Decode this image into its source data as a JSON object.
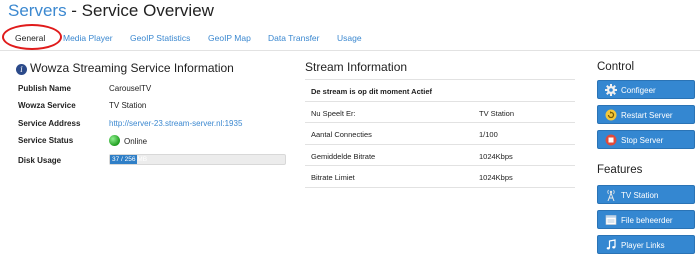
{
  "header": {
    "crumb": "Servers",
    "rest": " - Service Overview"
  },
  "tabs": [
    "General",
    "Media Player",
    "GeoIP Statistics",
    "GeoIP Map",
    "Data Transfer",
    "Usage"
  ],
  "info": {
    "title": "Wowza Streaming Service Information",
    "rows": [
      {
        "label": "Publish Name",
        "value": "CarouselTV"
      },
      {
        "label": "Wowza Service",
        "value": "TV Station"
      },
      {
        "label": "Service Address",
        "value": "http://server-23.stream-server.nl:1935"
      },
      {
        "label": "Service Status",
        "value": "Online"
      },
      {
        "label": "Disk Usage",
        "value": "37 / 256 MB"
      }
    ],
    "disk_usage_fraction": 0.156,
    "status_color": "#1f9d1f"
  },
  "stream": {
    "title": "Stream Information",
    "status_line": "De stream is op dit moment Actief",
    "rows": [
      {
        "label": "Nu Speelt Er:",
        "value": "TV Station"
      },
      {
        "label": "Aantal Connecties",
        "value": "1/100"
      },
      {
        "label": "Gemiddelde Bitrate",
        "value": "1024Kbps"
      },
      {
        "label": "Bitrate Limiet",
        "value": "1024Kbps"
      }
    ]
  },
  "control": {
    "heading": "Control",
    "buttons": [
      {
        "label": "Configeer",
        "icon": "gear-icon"
      },
      {
        "label": "Restart Server",
        "icon": "restart-icon"
      },
      {
        "label": "Stop Server",
        "icon": "stop-icon"
      }
    ]
  },
  "features": {
    "heading": "Features",
    "buttons": [
      {
        "label": "TV Station",
        "icon": "broadcast-icon"
      },
      {
        "label": "File beheerder",
        "icon": "file-manager-icon"
      },
      {
        "label": "Player Links",
        "icon": "music-note-icon"
      }
    ]
  },
  "colors": {
    "accent": "#3487d1",
    "link": "#3b88d0",
    "highlight_circle": "#e01b1b"
  }
}
